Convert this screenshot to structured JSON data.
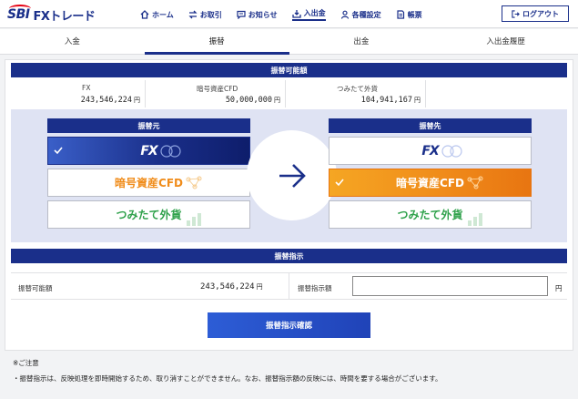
{
  "header": {
    "logo_sbi": "SBI",
    "logo_fx": "FXトレード",
    "nav": [
      {
        "label": "ホーム",
        "icon": "home-icon"
      },
      {
        "label": "お取引",
        "icon": "exchange-icon"
      },
      {
        "label": "お知らせ",
        "icon": "message-icon"
      },
      {
        "label": "入出金",
        "icon": "deposit-icon",
        "active": true
      },
      {
        "label": "各種設定",
        "icon": "user-icon"
      },
      {
        "label": "帳票",
        "icon": "document-icon"
      }
    ],
    "logout_label": "ログアウト"
  },
  "tabs": [
    {
      "label": "入金"
    },
    {
      "label": "振替",
      "active": true
    },
    {
      "label": "出金"
    },
    {
      "label": "入出金履歴"
    }
  ],
  "available": {
    "title": "振替可能額",
    "items": [
      {
        "label": "FX",
        "value": "243,546,224",
        "unit": "円"
      },
      {
        "label": "暗号資産CFD",
        "value": "50,000,000",
        "unit": "円"
      },
      {
        "label": "つみたて外貨",
        "value": "104,941,167",
        "unit": "円"
      }
    ]
  },
  "transfer": {
    "from_title": "振替元",
    "to_title": "振替先",
    "options": [
      "FX",
      "暗号資産CFD",
      "つみたて外貨"
    ],
    "from_selected": "FX",
    "to_selected": "暗号資産CFD",
    "colors": {
      "navy": "#1a2f8a",
      "orange": "#f08c1a",
      "green": "#2ea14a"
    }
  },
  "instruction": {
    "title": "振替指示",
    "available_label": "振替可能額",
    "available_value": "243,546,224",
    "unit": "円",
    "amount_label": "振替指示額",
    "amount_value": "",
    "confirm_label": "振替指示確認"
  },
  "notes": {
    "heading": "※ご注意",
    "items": [
      "・振替指示は、反映処理を即時開始するため、取り消すことができません。なお、振替指示額の反映には、時間を要する場合がございます。"
    ]
  }
}
